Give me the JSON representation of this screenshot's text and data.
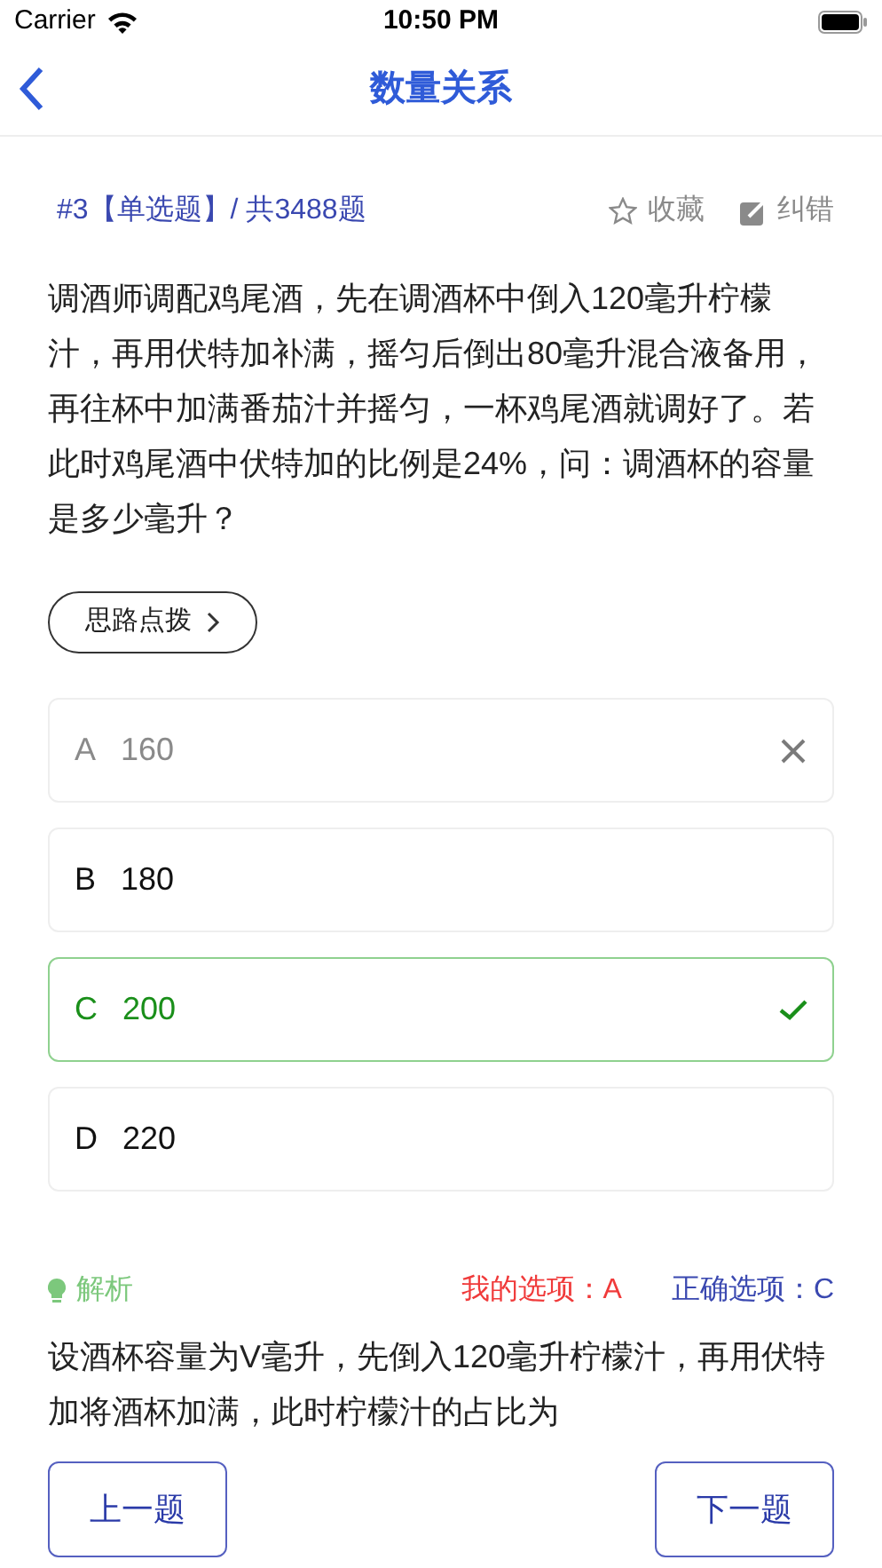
{
  "status_bar": {
    "carrier": "Carrier",
    "time": "10:50 PM"
  },
  "nav": {
    "title": "数量关系"
  },
  "question": {
    "number": "#3【单选题】/ 共3488题",
    "favorite": "收藏",
    "report": "纠错",
    "text": "调酒师调配鸡尾酒，先在调酒杯中倒入120毫升柠檬汁，再用伏特加补满，摇匀后倒出80毫升混合液备用，再往杯中加满番茄汁并摇匀，一杯鸡尾酒就调好了。若此时鸡尾酒中伏特加的比例是24%，问：调酒杯的容量是多少毫升？"
  },
  "hint_button": "思路点拨",
  "options": [
    {
      "letter": "A",
      "value": "160",
      "kind": "wrong"
    },
    {
      "letter": "B",
      "value": "180",
      "kind": "plain"
    },
    {
      "letter": "C",
      "value": "200",
      "kind": "correct"
    },
    {
      "letter": "D",
      "value": "220",
      "kind": "plain"
    }
  ],
  "analysis": {
    "label": "解析",
    "my_answer": "我的选项：A",
    "correct_answer": "正确选项：C",
    "text": "设酒杯容量为V毫升，先倒入120毫升柠檬汁，再用伏特加将酒杯加满，此时柠檬汁的占比为"
  },
  "buttons": {
    "previous": "上一题",
    "next": "下一题"
  }
}
